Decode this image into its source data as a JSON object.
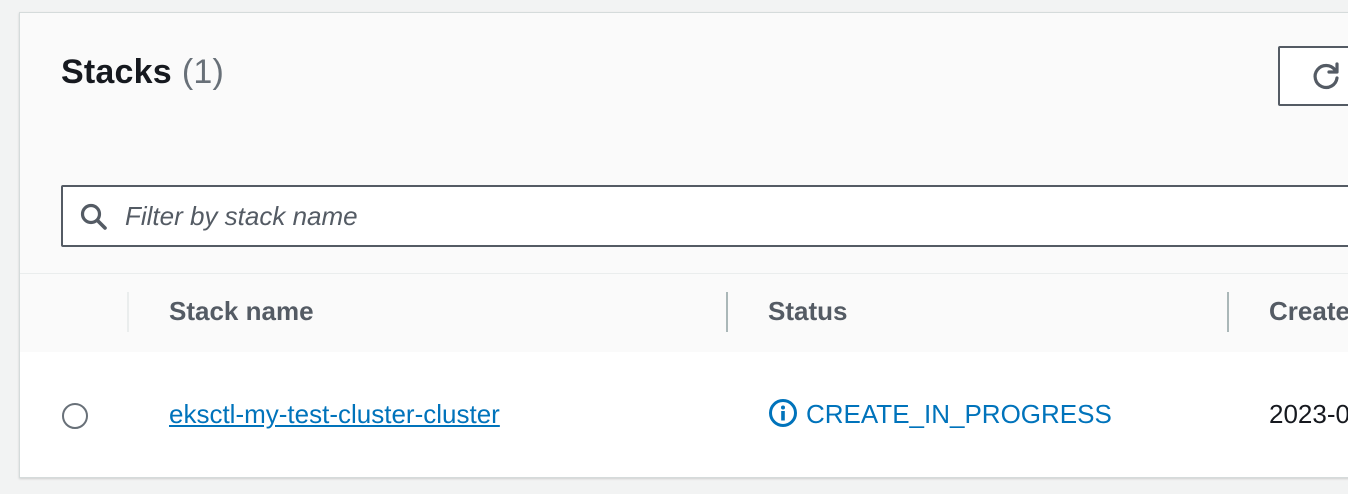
{
  "header": {
    "title": "Stacks",
    "count": "(1)"
  },
  "toolbar": {
    "refresh_icon": "refresh-icon"
  },
  "search": {
    "placeholder": "Filter by stack name",
    "value": "",
    "icon": "search-icon"
  },
  "table": {
    "columns": [
      "Stack name",
      "Status",
      "Create"
    ],
    "rows": [
      {
        "stack_name": "eksctl-my-test-cluster-cluster",
        "status": "CREATE_IN_PROGRESS",
        "status_icon": "info-icon",
        "created": "2023-0"
      }
    ]
  },
  "colors": {
    "link": "#0073bb",
    "status_in_progress": "#0073bb",
    "heading_text": "#16191f",
    "muted_text": "#687078",
    "border": "#545b64"
  }
}
